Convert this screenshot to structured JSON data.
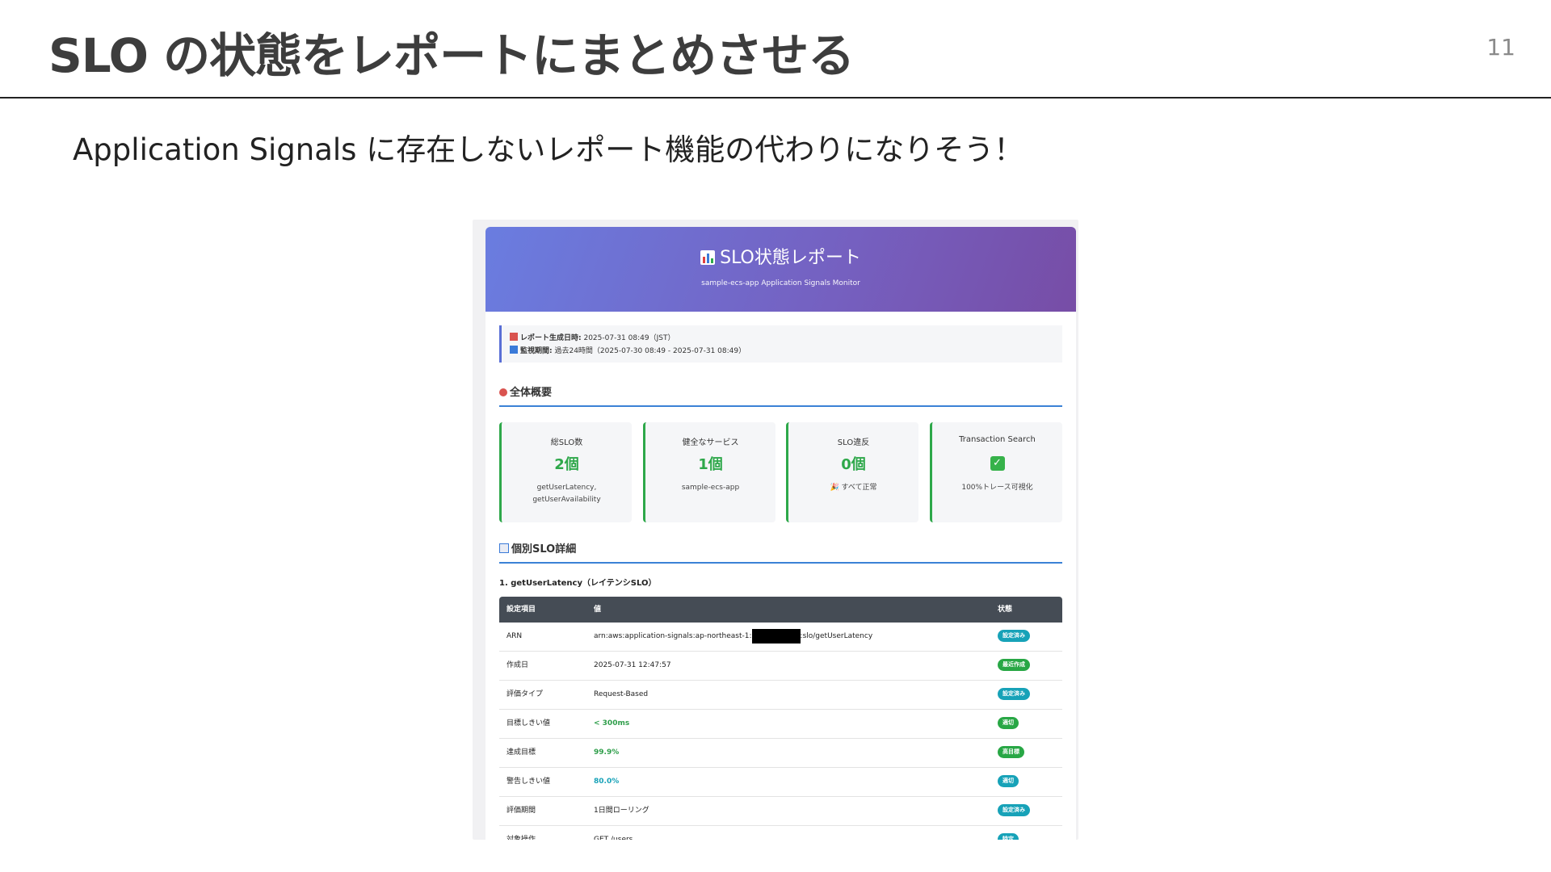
{
  "slide": {
    "title": "SLO の状態をレポートにまとめさせる",
    "page_number": "11",
    "subtitle": "Application Signals に存在しないレポート機能の代わりになりそう！"
  },
  "report": {
    "header_title": "SLO状態レポート",
    "header_subtitle": "sample-ecs-app Application Signals Monitor",
    "meta_generated_label": "レポート生成日時:",
    "meta_generated_value": "2025-07-31 08:49（JST）",
    "meta_period_label": "監視期間:",
    "meta_period_value": "過去24時間（2025-07-30 08:49 - 2025-07-31 08:49）",
    "overview_heading": "全体概要",
    "cards": [
      {
        "label": "総SLO数",
        "value": "2個",
        "note": "getUserLatency, getUserAvailability"
      },
      {
        "label": "健全なサービス",
        "value": "1個",
        "note": "sample-ecs-app"
      },
      {
        "label": "SLO違反",
        "value": "0個",
        "note": "すべて正常"
      },
      {
        "label": "Transaction Search",
        "value": "✓",
        "note": "100%トレース可視化"
      }
    ],
    "detail_heading": "個別SLO詳細",
    "slo_title": "1. getUserLatency（レイテンシSLO）",
    "table": {
      "headers": [
        "設定項目",
        "値",
        "状態"
      ],
      "rows": [
        {
          "item": "ARN",
          "value_prefix": "arn:aws:application-signals:ap-northeast-1:",
          "value_suffix": ":slo/getUserLatency",
          "badge": "設定済み",
          "badge_color": "#17a2b8",
          "value_style": ""
        },
        {
          "item": "作成日",
          "value": "2025-07-31 12:47:57",
          "badge": "最近作成",
          "badge_color": "#28a745",
          "value_style": ""
        },
        {
          "item": "評価タイプ",
          "value": "Request-Based",
          "badge": "設定済み",
          "badge_color": "#17a2b8",
          "value_style": ""
        },
        {
          "item": "目標しきい値",
          "value": "< 300ms",
          "badge": "適切",
          "badge_color": "#28a745",
          "value_style": "green"
        },
        {
          "item": "達成目標",
          "value": "99.9%",
          "badge": "高目標",
          "badge_color": "#28a745",
          "value_style": "green"
        },
        {
          "item": "警告しきい値",
          "value": "80.0%",
          "badge": "適切",
          "badge_color": "#17a2b8",
          "value_style": "teal"
        },
        {
          "item": "評価期間",
          "value": "1日間ローリング",
          "badge": "設定済み",
          "badge_color": "#17a2b8",
          "value_style": ""
        },
        {
          "item": "対象操作",
          "value": "GET /users",
          "badge": "特定",
          "badge_color": "#17a2b8",
          "value_style": ""
        }
      ]
    }
  },
  "colors": {
    "header_gradient_start": "#6a7de0",
    "header_gradient_end": "#774da6",
    "accent_green": "#2ea84a",
    "accent_blue": "#3b82d6",
    "table_header": "#454c55"
  }
}
